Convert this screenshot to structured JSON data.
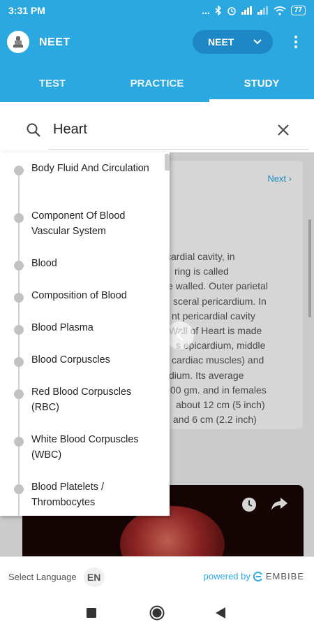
{
  "status_bar": {
    "time": "3:31 PM",
    "dots": "...",
    "battery": "77"
  },
  "header": {
    "title": "NEET",
    "exam_select": {
      "value": "NEET"
    },
    "tabs": [
      {
        "label": "TEST",
        "active": false
      },
      {
        "label": "PRACTICE",
        "active": false
      },
      {
        "label": "STUDY",
        "active": true
      }
    ]
  },
  "search": {
    "query": "Heart"
  },
  "topics": [
    "Body Fluid And Circulation",
    "Component Of Blood Vascular System",
    "Blood",
    "Composition of Blood",
    "Blood Plasma",
    "Blood Corpuscles",
    "Red Blood Corpuscles (RBC)",
    "White Blood Corpuscles (WBC)",
    "Blood Platelets / Thrombocytes"
  ],
  "card": {
    "next_label": "Next",
    "text_lines": [
      "cardial cavity, in",
      "ring is called",
      "e walled. Outer parietal",
      "sceral pericardium. In",
      "nt pericardial cavity",
      "Wall of Heart is made",
      "s epicardium, middle",
      "cardiac muscles) and",
      "dium. Its average",
      "00 gm. and in females",
      "about 12 cm (5 inch)",
      "and 6 cm (2.2 inch)"
    ]
  },
  "footer": {
    "language_label": "Select Language",
    "language_code": "EN",
    "powered_by": "powered by",
    "brand": "EMBIBE"
  },
  "colors": {
    "primary": "#2ba8e0",
    "primary_dark": "#1e88c7"
  }
}
